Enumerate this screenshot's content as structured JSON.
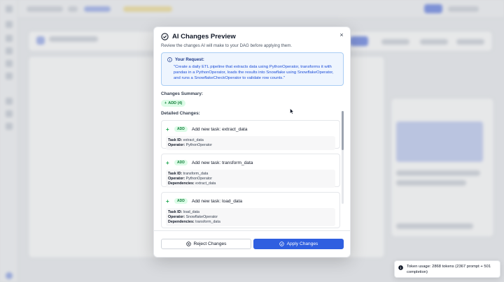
{
  "modal": {
    "title": "AI Changes Preview",
    "subtitle": "Review the changes AI will make to your DAG before applying them.",
    "close_label": "×",
    "request": {
      "label": "Your Request:",
      "text": "\"Create a daily ETL pipeline that extracts data using PythonOperator, transforms it with pandas in a PythonOperator, loads the results into Snowflake using SnowflakeOperator, and runs a SnowflakeCheckOperator to validate row counts.\""
    },
    "summary_label": "Changes Summary:",
    "summary_badge": "ADD (4)",
    "detailed_label": "Detailed Changes:",
    "changes": [
      {
        "tag": "ADD",
        "title": "Add new task: extract_data",
        "fields": [
          {
            "key": "Task ID:",
            "value": "extract_data"
          },
          {
            "key": "Operator:",
            "value": "PythonOperator"
          }
        ]
      },
      {
        "tag": "ADD",
        "title": "Add new task: transform_data",
        "fields": [
          {
            "key": "Task ID:",
            "value": "transform_data"
          },
          {
            "key": "Operator:",
            "value": "PythonOperator"
          },
          {
            "key": "Dependencies:",
            "value": "extract_data"
          }
        ]
      },
      {
        "tag": "ADD",
        "title": "Add new task: load_data",
        "fields": [
          {
            "key": "Task ID:",
            "value": "load_data"
          },
          {
            "key": "Operator:",
            "value": "SnowflakeOperator"
          },
          {
            "key": "Dependencies:",
            "value": "transform_data"
          }
        ]
      }
    ],
    "reject_label": "Reject Changes",
    "apply_label": "Apply Changes"
  },
  "toast": {
    "text": "Token usage: 2868 tokens (2367 prompt + 501 completion)"
  },
  "colors": {
    "accent": "#2f5fe0",
    "add_green": "#16a34a",
    "request_bg": "#eef5fe"
  }
}
